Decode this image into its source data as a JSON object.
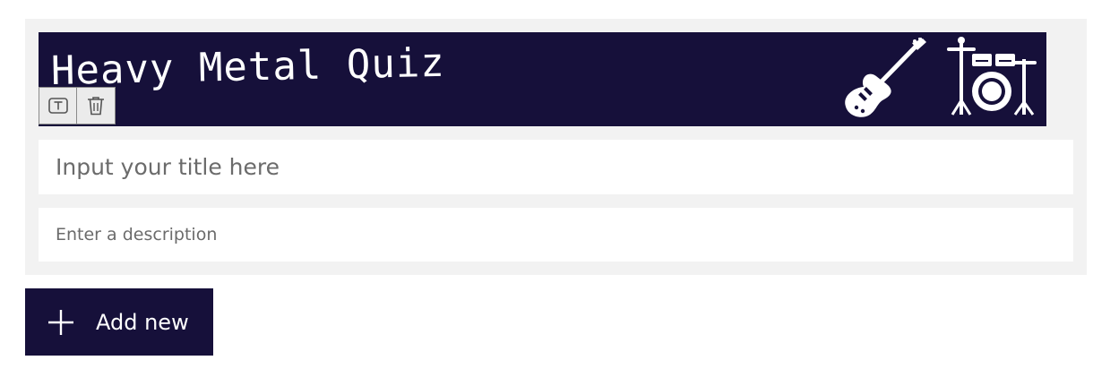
{
  "banner": {
    "title": "Heavy Metal Quiz"
  },
  "form": {
    "title_placeholder": "Input your title here",
    "description_placeholder": "Enter a description"
  },
  "image_toolbar": {
    "icons": [
      "text-icon",
      "trash-icon"
    ]
  },
  "actions": {
    "add_new_label": "Add new"
  },
  "colors": {
    "brand": "#16103a",
    "card_background": "#f2f2f2",
    "field_background": "#ffffff"
  }
}
